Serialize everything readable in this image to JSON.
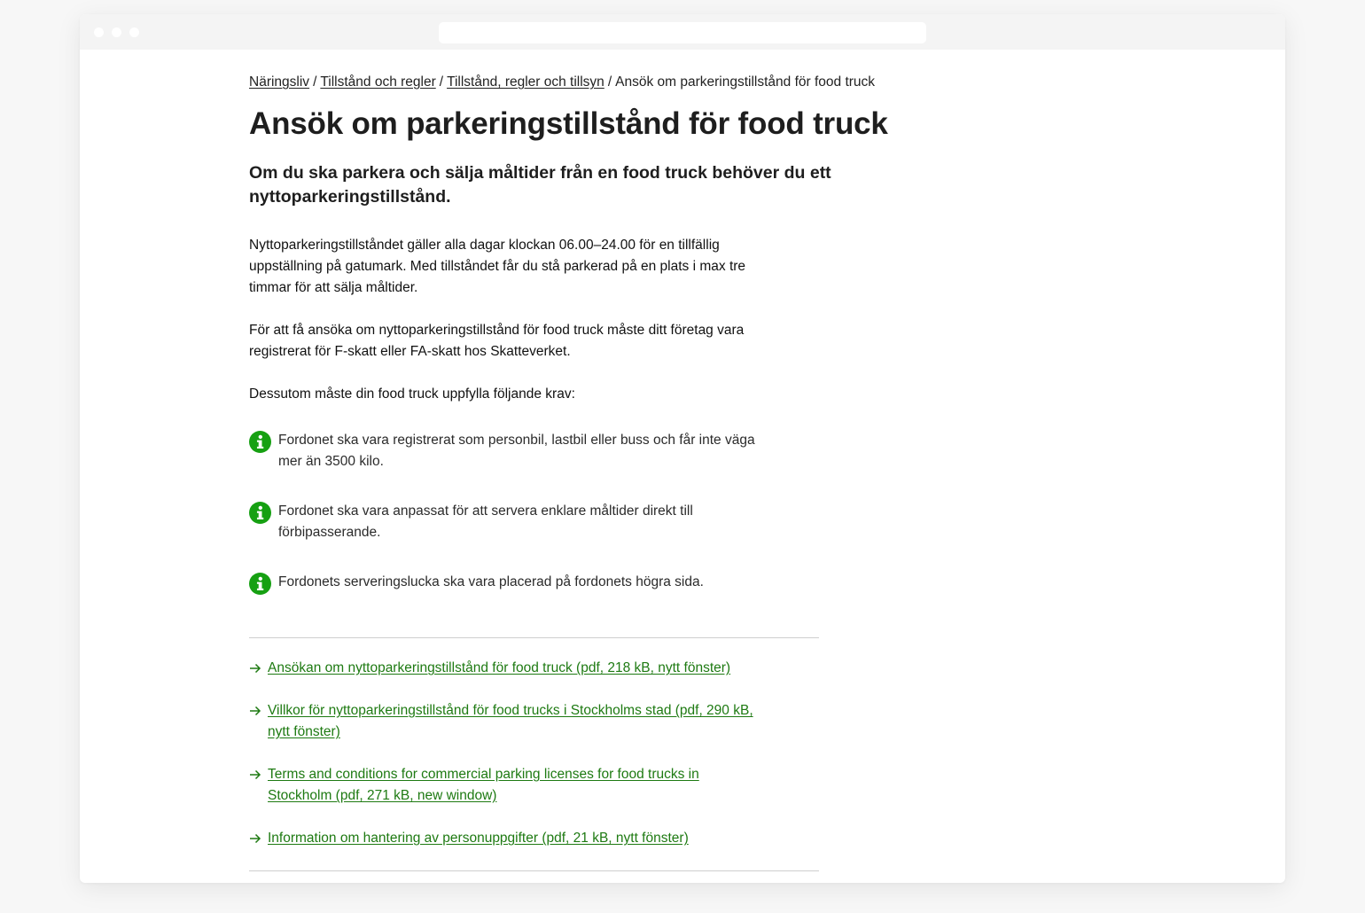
{
  "breadcrumb": {
    "items": [
      "Näringsliv",
      "Tillstånd och regler",
      "Tillstånd, regler och tillsyn"
    ],
    "current": "Ansök om parkeringstillstånd för food truck",
    "separator": "/"
  },
  "page": {
    "title": "Ansök om parkeringstillstånd för food truck",
    "lead": "Om du ska parkera och sälja måltider från en food truck behöver du ett nyttoparkeringstillstånd.",
    "paragraphs": [
      "Nyttoparkeringstillståndet gäller alla dagar klockan 06.00–24.00 för en tillfällig uppställning på gatumark. Med tillståndet får du stå parkerad på en plats i max tre timmar för att sälja måltider.",
      "För att få ansöka om nyttoparkeringstillstånd för food truck måste ditt företag vara registrerat för F-skatt eller FA-skatt hos Skatteverket.",
      "Dessutom måste din food truck uppfylla följande krav:"
    ],
    "requirements": [
      "Fordonet ska vara registrerat som personbil, lastbil eller buss och får inte väga mer än 3500 kilo.",
      "Fordonet ska vara anpassat för att servera enklare måltider direkt till förbipasserande.",
      "Fordonets serveringslucka ska vara placerad på fordonets högra sida."
    ],
    "links": [
      "Ansökan om nyttoparkeringstillstånd för food truck (pdf, 218 kB, nytt fönster)",
      "Villkor för nyttoparkeringstillstånd för food trucks i Stockholms stad (pdf, 290 kB, nytt fönster)",
      "Terms and conditions for commercial parking licenses for food trucks in Stockholm (pdf, 271 kB, new window)",
      "Information om hantering av personuppgifter (pdf, 21 kB, nytt fönster)"
    ]
  },
  "icons": {
    "requirement": "info-icon",
    "link": "arrow-right-icon"
  },
  "colors": {
    "accent_green": "#1e7a12",
    "icon_green": "#16a012",
    "text": "#222222"
  }
}
